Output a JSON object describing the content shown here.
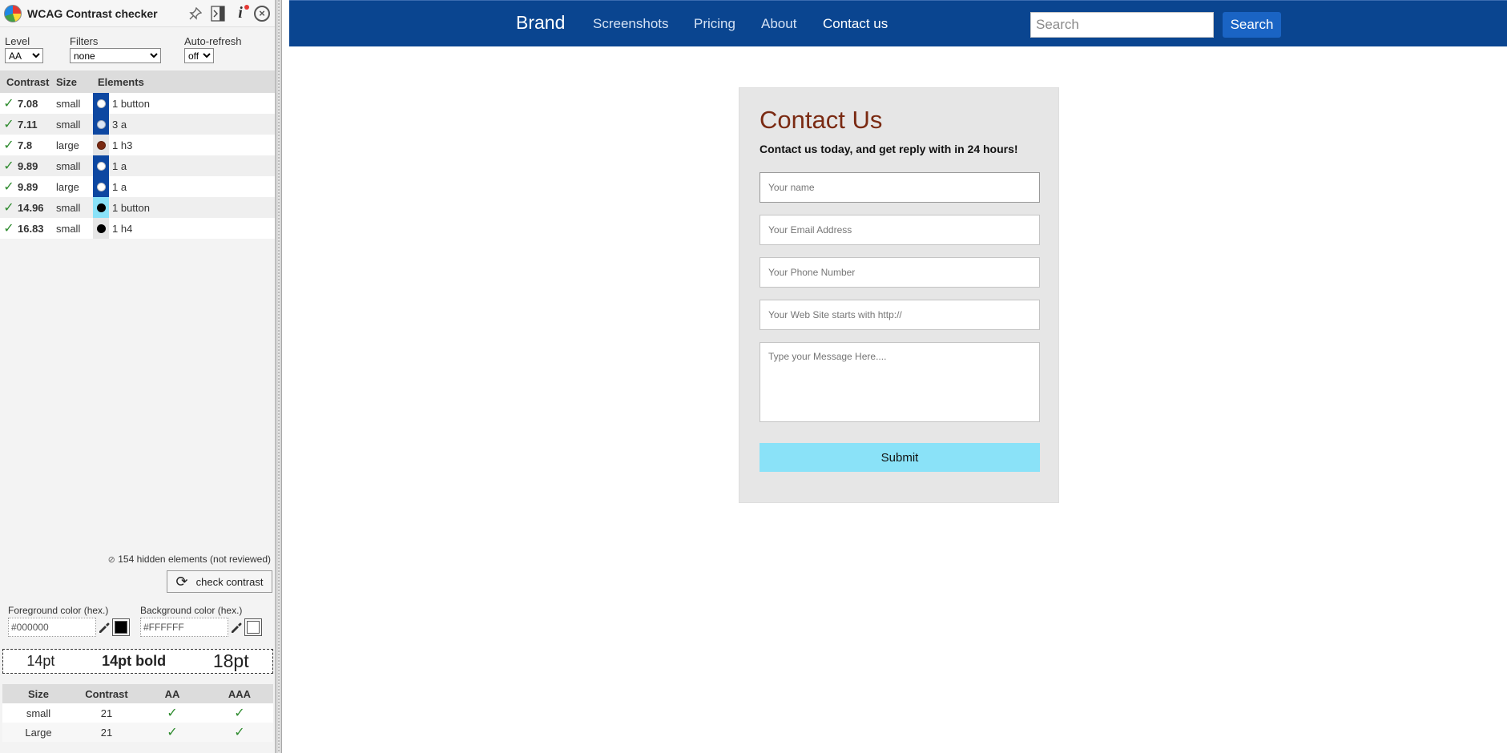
{
  "panel": {
    "title": "WCAG Contrast checker",
    "close_glyph": "×",
    "info_glyph": "i",
    "level": {
      "label": "Level",
      "value": "AA"
    },
    "filters": {
      "label": "Filters",
      "value": "none"
    },
    "auto_refresh": {
      "label": "Auto-refresh",
      "value": "off"
    },
    "columns": {
      "contrast": "Contrast",
      "size": "Size",
      "elements": "Elements"
    },
    "results": [
      {
        "contrast": "7.08",
        "size": "small",
        "elements": "1 button",
        "bg": "#0d47a1",
        "fg": "#ffffff"
      },
      {
        "contrast": "7.11",
        "size": "small",
        "elements": "3 a",
        "bg": "#0d47a1",
        "fg": "#dbe6f6"
      },
      {
        "contrast": "7.8",
        "size": "large",
        "elements": "1 h3",
        "bg": "#e6e6e6",
        "fg": "#7a2a12"
      },
      {
        "contrast": "9.89",
        "size": "small",
        "elements": "1 a",
        "bg": "#0d47a1",
        "fg": "#ffffff"
      },
      {
        "contrast": "9.89",
        "size": "large",
        "elements": "1 a",
        "bg": "#0d47a1",
        "fg": "#ffffff"
      },
      {
        "contrast": "14.96",
        "size": "small",
        "elements": "1 button",
        "bg": "#8ae2f8",
        "fg": "#000000"
      },
      {
        "contrast": "16.83",
        "size": "small",
        "elements": "1 h4",
        "bg": "#e6e6e6",
        "fg": "#000000"
      }
    ],
    "hidden_info": "154 hidden elements (not reviewed)",
    "check_button": "check contrast",
    "foreground": {
      "label": "Foreground color (hex.)",
      "value": "#000000",
      "swatch": "#000000"
    },
    "background": {
      "label": "Background color (hex.)",
      "value": "#FFFFFF",
      "swatch": "#ffffff"
    },
    "preview": {
      "normal": "14pt",
      "bold": "14pt bold",
      "large": "18pt"
    },
    "summary": {
      "headers": {
        "size": "Size",
        "contrast": "Contrast",
        "aa": "AA",
        "aaa": "AAA"
      },
      "rows": [
        {
          "size": "small",
          "contrast": "21",
          "aa": "✓",
          "aaa": "✓"
        },
        {
          "size": "Large",
          "contrast": "21",
          "aa": "✓",
          "aaa": "✓"
        }
      ]
    }
  },
  "site": {
    "brand": "Brand",
    "nav": [
      "Screenshots",
      "Pricing",
      "About",
      "Contact us"
    ],
    "search": {
      "placeholder": "Search",
      "button": "Search"
    },
    "contact": {
      "title": "Contact Us",
      "subtitle": "Contact us today, and get reply with in 24 hours!",
      "fields": {
        "name": "Your name",
        "email": "Your Email Address",
        "phone": "Your Phone Number",
        "website": "Your Web Site starts with http://",
        "message": "Type your Message Here...."
      },
      "submit": "Submit"
    }
  }
}
